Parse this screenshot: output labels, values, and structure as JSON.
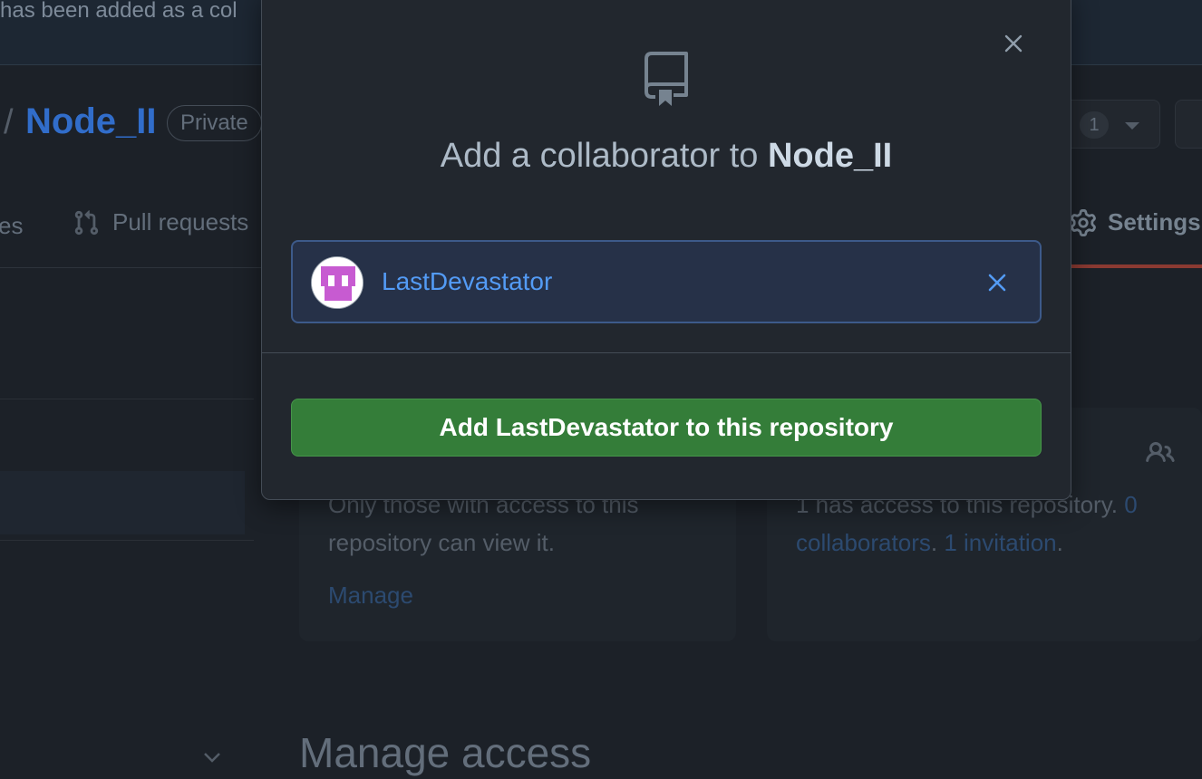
{
  "flash": {
    "text": "has been added as a col"
  },
  "repo": {
    "slash": "/",
    "name": "Node_II",
    "visibility_badge": "Private",
    "counter": "1"
  },
  "tabs": {
    "partial_left": "es",
    "pull_requests": "Pull requests",
    "settings": "Settings"
  },
  "cards": {
    "visibility_text_1": "Only those with access to this",
    "visibility_text_2": "repository can view it.",
    "manage_link": "Manage",
    "access_text_1": "1 has access to this repository.",
    "access_link_0": "0",
    "access_link_collaborators": "collaborators",
    "access_period": ".",
    "access_link_invitation": "1 invitation"
  },
  "section_heading": "Manage access",
  "modal": {
    "title_prefix": "Add a collaborator to ",
    "title_repo": "Node_II",
    "selected_user": "LastDevastator",
    "add_button_label": "Add LastDevastator to this repository"
  },
  "colors": {
    "accent_blue": "#539bf5",
    "primary_green": "#347d39",
    "modal_bg": "#22272e",
    "page_bg": "#1c2128"
  },
  "icons": {
    "repo": "repo-icon",
    "close": "close-icon",
    "remove_user": "x-icon",
    "pull_request": "git-pull-request-icon",
    "settings": "gear-icon",
    "people": "people-icon"
  }
}
